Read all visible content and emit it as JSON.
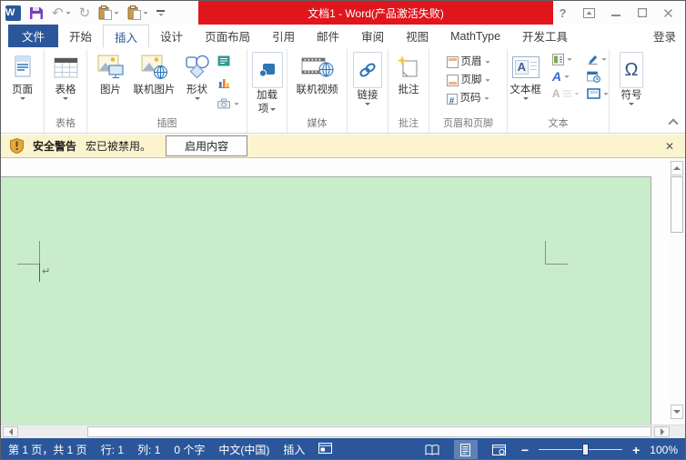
{
  "window": {
    "title": "文档1 -  Word(产品激活失败)",
    "help_glyph": "?"
  },
  "qat": {
    "word_letter": "W",
    "undo_glyph": "↶",
    "redo_glyph": "↻"
  },
  "tabs": {
    "file": "文件",
    "items": [
      {
        "label": "开始"
      },
      {
        "label": "插入"
      },
      {
        "label": "设计"
      },
      {
        "label": "页面布局"
      },
      {
        "label": "引用"
      },
      {
        "label": "邮件"
      },
      {
        "label": "审阅"
      },
      {
        "label": "视图"
      },
      {
        "label": "MathType"
      },
      {
        "label": "开发工具"
      }
    ],
    "sign_in": "登录"
  },
  "ribbon": {
    "pages": {
      "button": "页面"
    },
    "tables": {
      "button": "表格",
      "group": "表格"
    },
    "illustrations": {
      "pictures": "图片",
      "online_pictures": "联机图片",
      "shapes": "形状",
      "group": "插图"
    },
    "addins": {
      "line1": "加载",
      "line2": "项"
    },
    "media": {
      "online_video": "联机视频",
      "group": "媒体"
    },
    "links": {
      "button": "链接"
    },
    "comments": {
      "button": "批注",
      "group": "批注"
    },
    "header_footer": {
      "header": "页眉",
      "footer": "页脚",
      "page_number": "页码",
      "page_number_glyph": "#",
      "group": "页眉和页脚"
    },
    "text": {
      "textbox": "文本框",
      "textbox_glyph": "A",
      "wordart_glyph": "A",
      "dropcap_glyph": "A",
      "group": "文本"
    },
    "symbols": {
      "omega_glyph": "Ω",
      "button": "符号"
    }
  },
  "warning": {
    "title": "安全警告",
    "message": "宏已被禁用。",
    "action": "启用内容",
    "close_glyph": "✕"
  },
  "document": {
    "pilcrow_glyph": "↵"
  },
  "status": {
    "page_info": "第 1 页，共 1 页",
    "line": "行: 1",
    "column": "列: 1",
    "words": "0 个字",
    "language": "中文(中国)",
    "mode": "插入",
    "zoom_out_glyph": "−",
    "zoom_in_glyph": "+",
    "zoom_level": "100%"
  }
}
